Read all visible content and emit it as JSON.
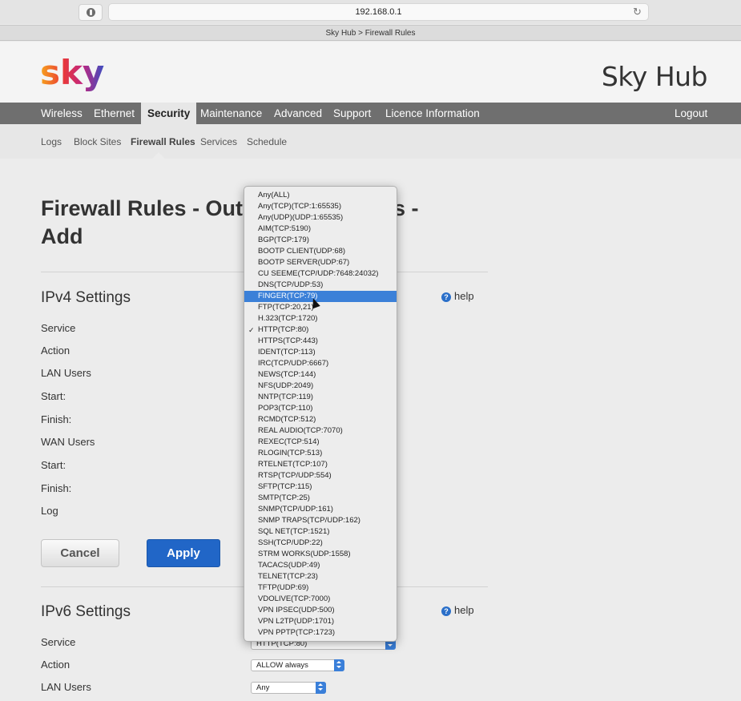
{
  "browser": {
    "url": "192.168.0.1",
    "tab_title": "Sky Hub > Firewall Rules",
    "reload_icon": "reload-icon",
    "shield_icon": "privacy-shield-icon"
  },
  "header": {
    "logo_text": "sky",
    "hub_title": "Sky Hub"
  },
  "nav": {
    "items": [
      "Wireless",
      "Ethernet",
      "Security",
      "Maintenance",
      "Advanced",
      "Support",
      "Licence Information"
    ],
    "active": "Security",
    "logout": "Logout"
  },
  "subnav": {
    "items": [
      "Logs",
      "Block Sites",
      "Firewall Rules",
      "Services",
      "Schedule"
    ],
    "active": "Firewall Rules"
  },
  "page": {
    "title_line1_left": "Firewall Rules - Out",
    "title_line1_right": "s -",
    "title_line2": "Add"
  },
  "ipv4": {
    "title": "IPv4 Settings",
    "help": "help",
    "labels": [
      "Service",
      "Action",
      "LAN Users",
      "Start:",
      "Finish:",
      "WAN Users",
      "Start:",
      "Finish:",
      "Log"
    ]
  },
  "buttons": {
    "cancel": "Cancel",
    "apply": "Apply"
  },
  "ipv6": {
    "title": "IPv6 Settings",
    "help": "help",
    "labels": [
      "Service",
      "Action",
      "LAN Users"
    ],
    "service_value": "HTTP(TCP:80)",
    "action_value": "ALLOW always",
    "lan_users_value": "Any"
  },
  "service_dropdown": {
    "selected": "HTTP(TCP:80)",
    "highlighted": "FINGER(TCP:79)",
    "options": [
      "Any(ALL)",
      "Any(TCP)(TCP:1:65535)",
      "Any(UDP)(UDP:1:65535)",
      "AIM(TCP:5190)",
      "BGP(TCP:179)",
      "BOOTP CLIENT(UDP:68)",
      "BOOTP SERVER(UDP:67)",
      "CU SEEME(TCP/UDP:7648:24032)",
      "DNS(TCP/UDP:53)",
      "FINGER(TCP:79)",
      "FTP(TCP:20,21)",
      "H.323(TCP:1720)",
      "HTTP(TCP:80)",
      "HTTPS(TCP:443)",
      "IDENT(TCP:113)",
      "IRC(TCP/UDP:6667)",
      "NEWS(TCP:144)",
      "NFS(UDP:2049)",
      "NNTP(TCP:119)",
      "POP3(TCP:110)",
      "RCMD(TCP:512)",
      "REAL AUDIO(TCP:7070)",
      "REXEC(TCP:514)",
      "RLOGIN(TCP:513)",
      "RTELNET(TCP:107)",
      "RTSP(TCP/UDP:554)",
      "SFTP(TCP:115)",
      "SMTP(TCP:25)",
      "SNMP(TCP/UDP:161)",
      "SNMP TRAPS(TCP/UDP:162)",
      "SQL NET(TCP:1521)",
      "SSH(TCP/UDP:22)",
      "STRM WORKS(UDP:1558)",
      "TACACS(UDP:49)",
      "TELNET(TCP:23)",
      "TFTP(UDP:69)",
      "VDOLIVE(TCP:7000)",
      "VPN IPSEC(UDP:500)",
      "VPN L2TP(UDP:1701)",
      "VPN PPTP(TCP:1723)"
    ]
  },
  "colors": {
    "nav_bg": "#6f6f6f",
    "accent_blue": "#2166c7",
    "highlight_blue": "#3b80d8"
  }
}
